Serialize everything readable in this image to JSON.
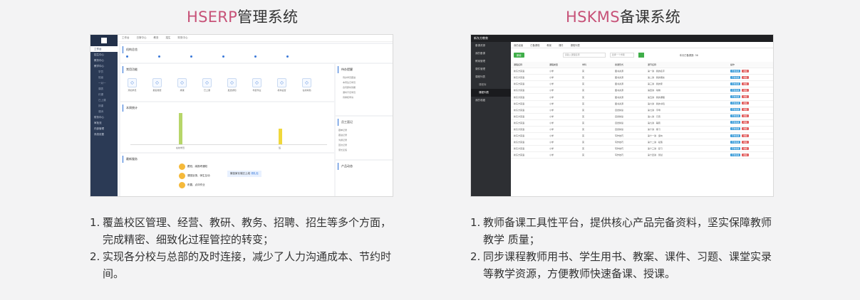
{
  "left": {
    "title_en": "HSERP",
    "title_cn": "管理系统",
    "items": [
      "覆盖校区管理、经营、教研、教务、招聘、招生等多个方面，完成精密、细致化过程管控的转变；",
      "实现各分校与总部的及时连接，减少了人力沟通成本、节约时间。"
    ]
  },
  "right": {
    "title_en": "HSKMS",
    "title_cn": "备课系统",
    "items": [
      "教师备课工具性平台，提供核心产品完备资料，坚实保障教师教学 质量；",
      "同步课程教师用书、学生用书、教案、课件、习题、课堂实录等教学资源，方便教师快速备课、授课。"
    ]
  },
  "numbers": [
    "1.",
    "2."
  ],
  "erp": {
    "topnav": [
      "工作台",
      "日常中心",
      "教务",
      "招生",
      "财务中心"
    ],
    "sidebar": [
      "工作台",
      "招生中心",
      "教务中心",
      "教学中心",
      "学员",
      "班级",
      "一对一",
      "课表",
      "约课",
      "已上课",
      "排课",
      "课消",
      "财务中心",
      "审批流",
      "内部管理",
      "系统设置"
    ],
    "sections": {
      "stats": "机构总览",
      "quick": "常用功能",
      "chart": "本周统计",
      "notice": "最新服务",
      "todo": "待办提醒",
      "log": "员工面记",
      "product": "产品动态"
    },
    "quick_links": [
      "添加学员",
      "报名缴费",
      "排课",
      "已上课",
      "发送通知",
      "布置作业",
      "机构设置",
      "在线考勤"
    ],
    "chart_labels": [
      "在校学员",
      "班"
    ],
    "notice_lines": [
      "跟班、续报考通知",
      "课堂反馈、师生互动",
      "布置、点评作业"
    ],
    "promo": "微信家长端已上线",
    "promo_link": "领礼包",
    "todo_items": [
      "待办学员跟进",
      "本周生日学员",
      "合同即将到期",
      "课时不足学员",
      "待审核申请"
    ],
    "log_items": [
      "跟单记录",
      "跟进记录",
      "沟通记录",
      "回访记录",
      "家长反馈"
    ]
  },
  "kms": {
    "logo": "新东方教育",
    "sidebar": [
      "备课资源",
      "我的备课",
      "教案管理",
      "课件管理",
      "课程列表",
      "课程库",
      "课程列表",
      "我的收藏"
    ],
    "tabs": [
      "我的桌面",
      "已备课程",
      "教案",
      "课件",
      "课程列表"
    ],
    "add_btn": "新增",
    "search_placeholder": "请输入课程名称",
    "filter": "选择一个学期",
    "count_label": "本月已备课数: 36",
    "headers": [
      "课程名称",
      "课程类型",
      "学科",
      "授课形式",
      "课节名称",
      "操作"
    ],
    "rows": [
      [
        "新东方英语",
        "小学",
        "英",
        "图书资源",
        "第一讲 · 我的名字"
      ],
      [
        "新东方英语",
        "小学",
        "英",
        "图书资源",
        "第二讲 · 我的朋友"
      ],
      [
        "新东方英语",
        "小学",
        "英",
        "图书资源",
        "第三讲 · 我的家"
      ],
      [
        "新东方英语",
        "小学",
        "英",
        "图书资源",
        "第四讲 · 动物"
      ],
      [
        "新东方英语",
        "小学",
        "英",
        "图书资源",
        "第五讲 · 我的课程"
      ],
      [
        "新东方英语",
        "小学",
        "英",
        "图书资源",
        "第六讲 · 我的书包"
      ],
      [
        "新东方英语",
        "小学",
        "英",
        "自然拼读",
        "第七讲 · 字母"
      ],
      [
        "新东方英语",
        "小学",
        "英",
        "自然拼读",
        "第八讲 · 元音"
      ],
      [
        "新东方英语",
        "小学",
        "英",
        "自然拼读",
        "第九讲 · 辅音"
      ],
      [
        "新东方英语",
        "小学",
        "英",
        "自然拼读",
        "第十讲 · 练习"
      ],
      [
        "新东方英语",
        "小学",
        "英",
        "写作技巧",
        "第十一讲 · 造句"
      ],
      [
        "新东方英语",
        "小学",
        "英",
        "写作技巧",
        "第十二讲 · 段落"
      ],
      [
        "新东方英语",
        "小学",
        "英",
        "写作技巧",
        "第十三讲 · 复习"
      ],
      [
        "新东方英语",
        "小学",
        "英",
        "写作技巧",
        "第十四讲 · 测试"
      ]
    ],
    "action_edit": "开始备课",
    "action_del": "收藏"
  }
}
